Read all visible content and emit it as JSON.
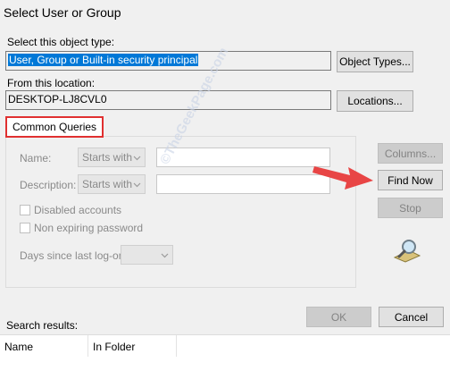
{
  "window": {
    "title": "Select User or Group"
  },
  "object_type": {
    "label": "Select this object type:",
    "value": "User, Group or Built-in security principal",
    "button": "Object Types..."
  },
  "location": {
    "label": "From this location:",
    "value": "DESKTOP-LJ8CVL0",
    "button": "Locations..."
  },
  "queries": {
    "tab_label": "Common Queries",
    "name_label": "Name:",
    "name_mode": "Starts with",
    "description_label": "Description:",
    "description_mode": "Starts with",
    "disabled_accounts": "Disabled accounts",
    "non_expiring_password": "Non expiring password",
    "days_since_logon": "Days since last log-on:"
  },
  "side_buttons": {
    "columns": "Columns...",
    "find_now": "Find Now",
    "stop": "Stop"
  },
  "footer": {
    "search_results": "Search results:",
    "ok": "OK",
    "cancel": "Cancel"
  },
  "results_columns": [
    "Name",
    "In Folder"
  ],
  "watermark": "©TheGeekPage.com",
  "colors": {
    "selection": "#0078d7",
    "highlight_box": "#e03030",
    "arrow": "#e84545"
  },
  "icons": {
    "chevron": "chevron-down-icon",
    "search": "search-icon",
    "arrow": "arrow-right-icon"
  }
}
